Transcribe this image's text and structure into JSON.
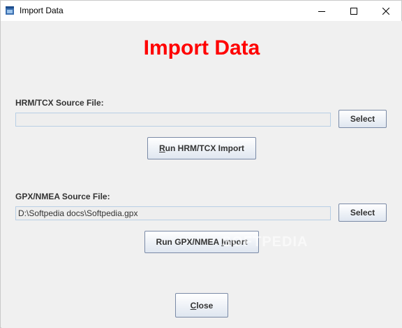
{
  "window": {
    "title": "Import Data",
    "icons": {
      "app": "java-cup-icon",
      "minimize": "minimize-icon",
      "maximize": "maximize-icon",
      "close": "close-icon"
    }
  },
  "main": {
    "heading": "Import Data",
    "hrm": {
      "label": "HRM/TCX Source File:",
      "value": "",
      "select_label": "Select",
      "run_mnemonic": "R",
      "run_label_rest": "un HRM/TCX Import"
    },
    "gpx": {
      "label": "GPX/NMEA Source File:",
      "value": "D:\\Softpedia docs\\Softpedia.gpx",
      "select_label": "Select",
      "run_label_start": "Run GPX/NMEA ",
      "run_mnemonic": "I",
      "run_label_rest": "mport"
    },
    "close_mnemonic": "C",
    "close_label_rest": "lose",
    "watermark": "SOFTPEDIA"
  },
  "colors": {
    "heading": "#ff0000",
    "background": "#f0f0f0",
    "field_border": "#b8cfe5"
  }
}
